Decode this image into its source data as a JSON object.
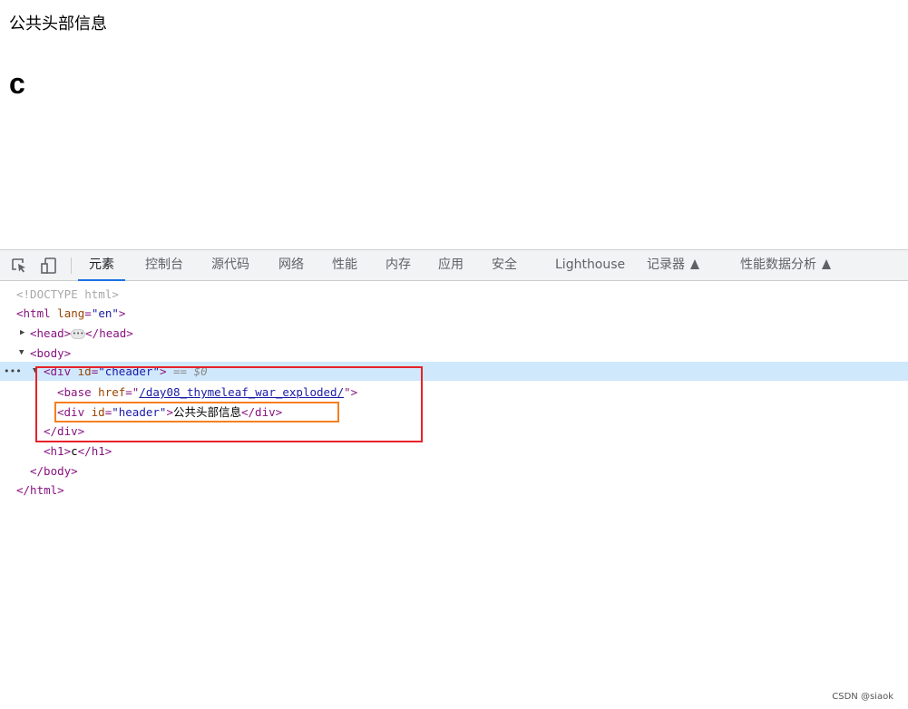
{
  "page": {
    "header_text": "公共头部信息",
    "h1_text": "c"
  },
  "devtools": {
    "tabs": [
      {
        "label": "元素",
        "active": true
      },
      {
        "label": "控制台"
      },
      {
        "label": "源代码"
      },
      {
        "label": "网络"
      },
      {
        "label": "性能"
      },
      {
        "label": "内存"
      },
      {
        "label": "应用"
      },
      {
        "label": "安全"
      },
      {
        "label": "Lighthouse"
      },
      {
        "label": "记录器",
        "icon": "flask-icon"
      },
      {
        "label": "性能数据分析",
        "icon": "flask-icon"
      }
    ],
    "dom": {
      "doctype": "<!DOCTYPE html>",
      "html_open": "<html",
      "html_attr": "lang",
      "html_val": "\"en\"",
      "head_open": "<head>",
      "head_close": "</head>",
      "body_open": "<body>",
      "div_open": "<div",
      "div_attr": "id",
      "div_val": "\"cheader\"",
      "selected_marker": "== $0",
      "base_open": "<base",
      "base_attr": "href",
      "base_href": "/day08_thymeleaf_war_exploded/",
      "inner_div_attr": "id",
      "inner_div_val": "\"header\"",
      "inner_div_text": "公共头部信息",
      "div_close": "</div>",
      "h1_open": "<h1>",
      "h1_text": "c",
      "h1_close": "</h1>",
      "body_close": "</body>",
      "html_close": "</html>"
    },
    "highlight_colors": {
      "red_box": "#e8222a",
      "orange_box": "#f77f1e",
      "selected_row": "#cfe8fc"
    }
  },
  "watermark": "CSDN @siaok"
}
